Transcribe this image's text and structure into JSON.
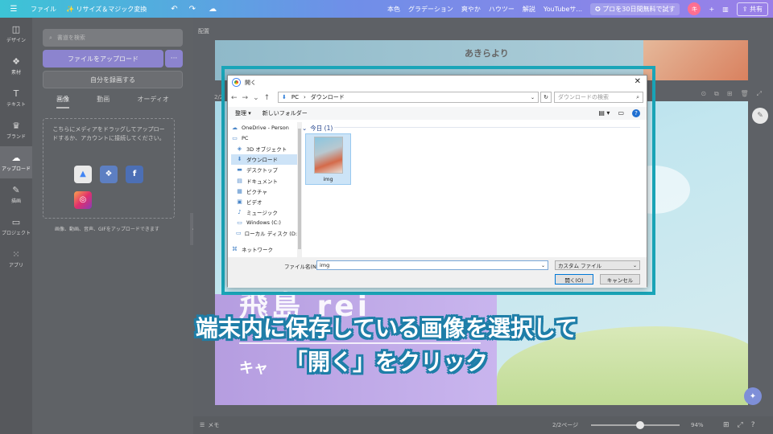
{
  "topbar": {
    "menu_icon": "hamburger-icon",
    "file": "ファイル",
    "resize": "リサイズ＆マジック変換",
    "right_items": [
      "本色",
      "グラデーション",
      "爽やか",
      "ハウツー",
      "解説",
      "YouTubeサ..."
    ],
    "pro_trial": "プロを30日間無料で試す",
    "avatar_letter": "キ",
    "share": "共有",
    "accent": "#6f8fe8"
  },
  "rail": {
    "items": [
      {
        "icon": "design-icon",
        "glyph": "◫",
        "label": "デザイン"
      },
      {
        "icon": "elements-icon",
        "glyph": "❖",
        "label": "素材"
      },
      {
        "icon": "text-icon",
        "glyph": "T",
        "label": "テキスト"
      },
      {
        "icon": "brand-icon",
        "glyph": "♛",
        "label": "ブランド"
      },
      {
        "icon": "upload-icon",
        "glyph": "☁",
        "label": "アップロード"
      },
      {
        "icon": "draw-icon",
        "glyph": "✎",
        "label": "描画"
      },
      {
        "icon": "projects-icon",
        "glyph": "▭",
        "label": "プロジェクト"
      },
      {
        "icon": "apps-icon",
        "glyph": "⁙",
        "label": "アプリ"
      }
    ]
  },
  "panel": {
    "search_placeholder": "書道を検索",
    "upload_button": "ファイルをアップロード",
    "more": "···",
    "record_button": "自分を録画する",
    "tabs": [
      "画像",
      "動画",
      "オーディオ"
    ],
    "dropzone_text": "こちらにメディアをドラッグしてアップロードするか、アカウントに接続してください。",
    "note": "画像、動画、音声、GIFをアップロードできます"
  },
  "canvas": {
    "layout_label": "配置",
    "page_top_brand": "あきらより",
    "page_number": "2/2",
    "big_title": "飛島 rei",
    "subtitle": "キャ"
  },
  "bottombar": {
    "memo": "メモ",
    "pages": "2/2ページ",
    "zoom": "94%",
    "zoom_fraction": 0.55
  },
  "dialog": {
    "title": "開く",
    "path": [
      "PC",
      "ダウンロード"
    ],
    "search_placeholder": "ダウンロードの検索",
    "organize": "整理 ▾",
    "new_folder": "新しいフォルダー",
    "nav": [
      {
        "label": "OneDrive - Person",
        "icon": "onedrive-icon",
        "glyph": "☁",
        "level": 0
      },
      {
        "label": "PC",
        "icon": "pc-icon",
        "glyph": "▭",
        "level": 0
      },
      {
        "label": "3D オブジェクト",
        "icon": "3d-objects-icon",
        "glyph": "◈",
        "level": 1
      },
      {
        "label": "ダウンロード",
        "icon": "downloads-icon",
        "glyph": "⬇",
        "level": 1,
        "selected": true
      },
      {
        "label": "デスクトップ",
        "icon": "desktop-icon",
        "glyph": "▬",
        "level": 1
      },
      {
        "label": "ドキュメント",
        "icon": "documents-icon",
        "glyph": "▤",
        "level": 1
      },
      {
        "label": "ピクチャ",
        "icon": "pictures-icon",
        "glyph": "▦",
        "level": 1
      },
      {
        "label": "ビデオ",
        "icon": "videos-icon",
        "glyph": "▣",
        "level": 1
      },
      {
        "label": "ミュージック",
        "icon": "music-icon",
        "glyph": "♪",
        "level": 1
      },
      {
        "label": "Windows (C:)",
        "icon": "drive-c-icon",
        "glyph": "▭",
        "level": 1
      },
      {
        "label": "ローカル ディスク (D:)",
        "icon": "drive-d-icon",
        "glyph": "▭",
        "level": 1
      },
      {
        "label": "ネットワーク",
        "icon": "network-icon",
        "glyph": "⌘",
        "level": 0
      }
    ],
    "group": "今日 (1)",
    "file_name": "img",
    "file_name_label": "ファイル名(N):",
    "file_name_value": "img",
    "file_type": "カスタム ファイル",
    "open": "開く(O)",
    "cancel": "キャンセル"
  },
  "caption": {
    "line1": "端末内に保存している画像を選択して",
    "line2": "「開く」をクリック"
  }
}
